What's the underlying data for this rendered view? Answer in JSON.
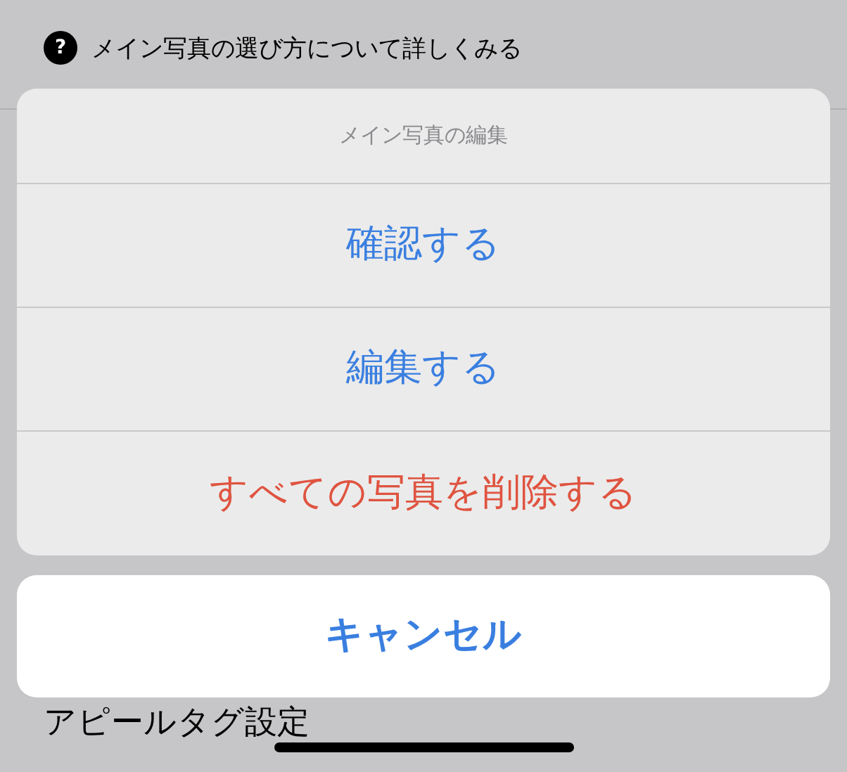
{
  "background": {
    "help_link": {
      "icon": "?",
      "text": "メイン写真の選び方について詳しくみる"
    },
    "section_title": "アピールタグ設定"
  },
  "action_sheet": {
    "title": "メイン写真の編集",
    "actions": [
      {
        "label": "確認する",
        "kind": "default"
      },
      {
        "label": "編集する",
        "kind": "default"
      },
      {
        "label": "すべての写真を削除する",
        "kind": "destructive"
      }
    ],
    "cancel": "キャンセル"
  }
}
